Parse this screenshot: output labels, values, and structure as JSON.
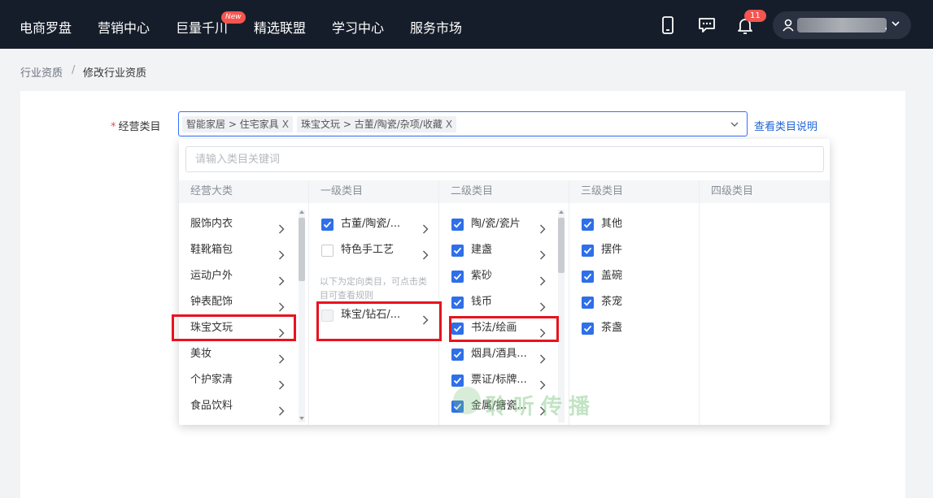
{
  "nav": {
    "items": [
      "电商罗盘",
      "营销中心",
      "巨量千川",
      "精选联盟",
      "学习中心",
      "服务市场"
    ],
    "new_badge": "New",
    "bell_count": "11",
    "user_suffix": "."
  },
  "breadcrumb": {
    "parent": "行业资质",
    "separator": "/",
    "current": "修改行业资质"
  },
  "form": {
    "label": "经营类目",
    "required_mark": "*",
    "tags": [
      "智能家居 > 住宅家具",
      "珠宝文玩 > 古董/陶瓷/杂项/收藏"
    ],
    "tag_close": "X",
    "view_link": "查看类目说明"
  },
  "dropdown": {
    "search_placeholder": "请输入类目关键词",
    "columns": {
      "major": {
        "header": "经营大类",
        "items": [
          "服饰内衣",
          "鞋靴箱包",
          "运动户外",
          "钟表配饰",
          "珠宝文玩",
          "美妆",
          "个护家清",
          "食品饮料"
        ]
      },
      "level1": {
        "header": "一级类目",
        "items": [
          {
            "label": "古董/陶瓷/...",
            "checked": true
          },
          {
            "label": "特色手工艺",
            "checked": false
          }
        ],
        "note": "以下为定向类目，可点击类目可查看规则",
        "restricted": {
          "label": "珠宝/钻石/...",
          "checked": false,
          "disabled": true
        }
      },
      "level2": {
        "header": "二级类目",
        "items": [
          "陶/瓷/瓷片",
          "建盏",
          "紫砂",
          "钱币",
          "书法/绘画",
          "烟具/酒具...",
          "票证/标牌...",
          "金属/搪瓷..."
        ]
      },
      "level3": {
        "header": "三级类目",
        "items": [
          "其他",
          "摆件",
          "盖碗",
          "茶宠",
          "茶盏"
        ]
      },
      "level4": {
        "header": "四级类目"
      }
    }
  },
  "watermark": "聆听传播",
  "colors": {
    "nav_bg": "#161d2a",
    "accent": "#2f6fe8",
    "link": "#1f63d8",
    "highlight": "#e8131f",
    "badge": "#f5554f"
  }
}
